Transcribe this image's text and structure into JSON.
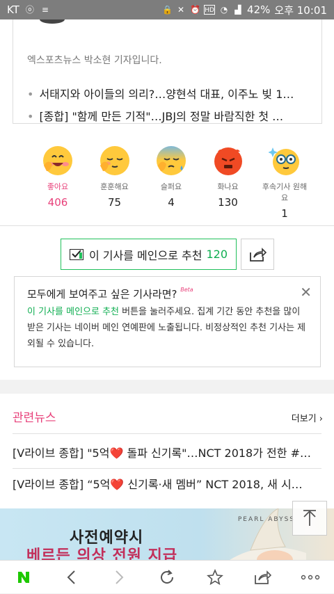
{
  "status": {
    "carrier": "KT",
    "battery": "42%",
    "time": "오후 10:01"
  },
  "article": {
    "byline": "엑스포츠뉴스 박소현 기자입니다.",
    "related": [
      "서태지와 아이들의 의리?…양현석 대표, 이주노 빚 1…",
      "[종합] \"함께 만든 기적\"…JBJ의 정말 바람직한 첫 …"
    ]
  },
  "reactions": [
    {
      "label": "좋아요",
      "count": "406",
      "active": true
    },
    {
      "label": "훈훈해요",
      "count": "75",
      "active": false
    },
    {
      "label": "슬퍼요",
      "count": "4",
      "active": false
    },
    {
      "label": "화나요",
      "count": "130",
      "active": false
    },
    {
      "label": "후속기사 원해요",
      "count": "1",
      "active": false
    }
  ],
  "recommend": {
    "label": "이 기사를 메인으로 추천",
    "count": "120"
  },
  "tip": {
    "title": "모두에게 보여주고 싶은 기사라면?",
    "beta": "Beta",
    "highlight": "이 기사를 메인으로 추천",
    "text": " 버튼을 눌러주세요. 집계 기간 동안 추천을 많이 받은 기사는 네이버 메인 연예판에 노출됩니다. 비정상적인 추천 기사는 제외될 수 있습니다."
  },
  "news": {
    "heading": "관련뉴스",
    "more": "더보기 ›",
    "items": [
      "[V라이브 종합] \"5억❤️ 돌파 신기록\"…NCT 2018가 전한 #…",
      "[V라이브 종합] “5억❤️ 신기록·새 멤버” NCT 2018, 새 시…"
    ]
  },
  "ad": {
    "line1": "사전예약시",
    "line2": "베르든 의상 전원 지급",
    "brand": "PEARL ABYSS"
  },
  "colors": {
    "accent": "#e8407a",
    "green": "#20c05b"
  }
}
